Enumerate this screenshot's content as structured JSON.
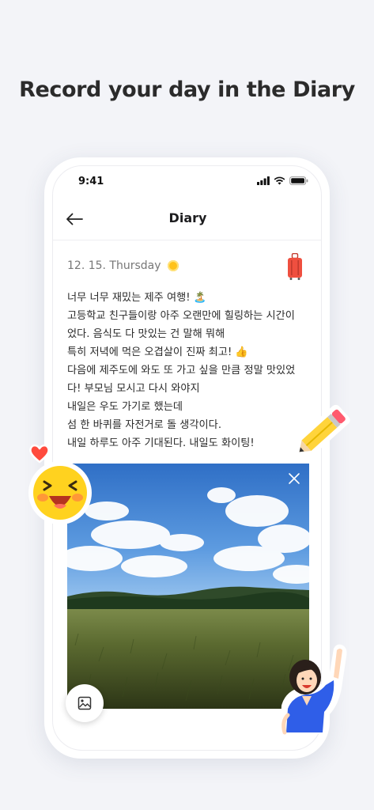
{
  "headline": "Record your day in the Diary",
  "status_bar": {
    "time": "9:41"
  },
  "nav": {
    "title": "Diary"
  },
  "entry": {
    "date": "12. 15. Thursday",
    "lines": [
      "너무 너무 재밌는 제주 여행! 🏝️",
      "고등학교 친구들이랑 아주 오랜만에 힐링하는 시간이",
      "었다. 음식도 다 맛있는 건 말해 뭐해",
      "특히 저녁에 먹은 오겹살이 진짜 최고! 👍",
      "다음에 제주도에 와도 또 가고 싶을 만큼 정말 맛있었",
      "다! 부모님 모시고 다시 와야지",
      "내일은 우도 가기로 했는데",
      "섬 한 바퀴를 자전거로 돌 생각이다.",
      "내일 하루도 아주 기대된다. 내일도 화이팅!"
    ]
  },
  "icons": {
    "back": "arrow-left-icon",
    "weather": "sun-icon",
    "mood": "suitcase-icon",
    "photo_remove": "close-icon",
    "gallery": "image-icon",
    "stickers": [
      "heart-sticker",
      "laughing-face-sticker",
      "pencil-sticker",
      "cheering-girl-sticker"
    ]
  },
  "colors": {
    "background": "#f3f4f8",
    "sun": "#ffc21a",
    "suitcase": "#ef4f3f",
    "pencil": "#ffd43b",
    "heart": "#ff4a3d"
  }
}
